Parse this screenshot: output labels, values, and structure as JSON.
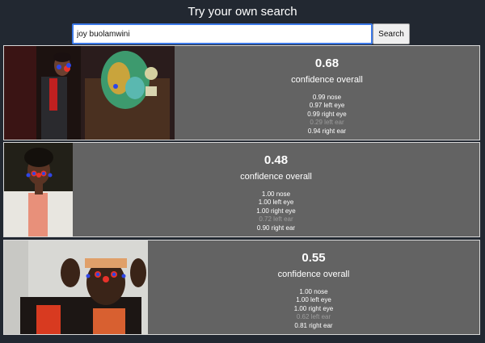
{
  "header": {
    "title": "Try your own search"
  },
  "search": {
    "value": "joy buolamwini",
    "button_label": "Search"
  },
  "results": [
    {
      "score": "0.68",
      "caption": "confidence overall",
      "keypoints": [
        {
          "text": "0.99 nose",
          "dim": false
        },
        {
          "text": "0.97 left eye",
          "dim": false
        },
        {
          "text": "0.99 right eye",
          "dim": false
        },
        {
          "text": "0.29 left ear",
          "dim": true
        },
        {
          "text": "0.94 right ear",
          "dim": false
        }
      ]
    },
    {
      "score": "0.48",
      "caption": "confidence overall",
      "keypoints": [
        {
          "text": "1.00 nose",
          "dim": false
        },
        {
          "text": "1.00 left eye",
          "dim": false
        },
        {
          "text": "1.00 right eye",
          "dim": false
        },
        {
          "text": "0.72 left ear",
          "dim": true
        },
        {
          "text": "0.90 right ear",
          "dim": false
        }
      ]
    },
    {
      "score": "0.55",
      "caption": "confidence overall",
      "keypoints": [
        {
          "text": "1.00 nose",
          "dim": false
        },
        {
          "text": "1.00 left eye",
          "dim": false
        },
        {
          "text": "1.00 right eye",
          "dim": false
        },
        {
          "text": "0.62 left ear",
          "dim": true
        },
        {
          "text": "0.81 right ear",
          "dim": false
        }
      ]
    }
  ],
  "colors": {
    "background": "#222831",
    "card": "#636363",
    "input_border": "#3b78e7",
    "dim_text": "#9c9c9c",
    "keypoint_nose": "#e8322a",
    "keypoint_eye": "#2f46e6"
  }
}
